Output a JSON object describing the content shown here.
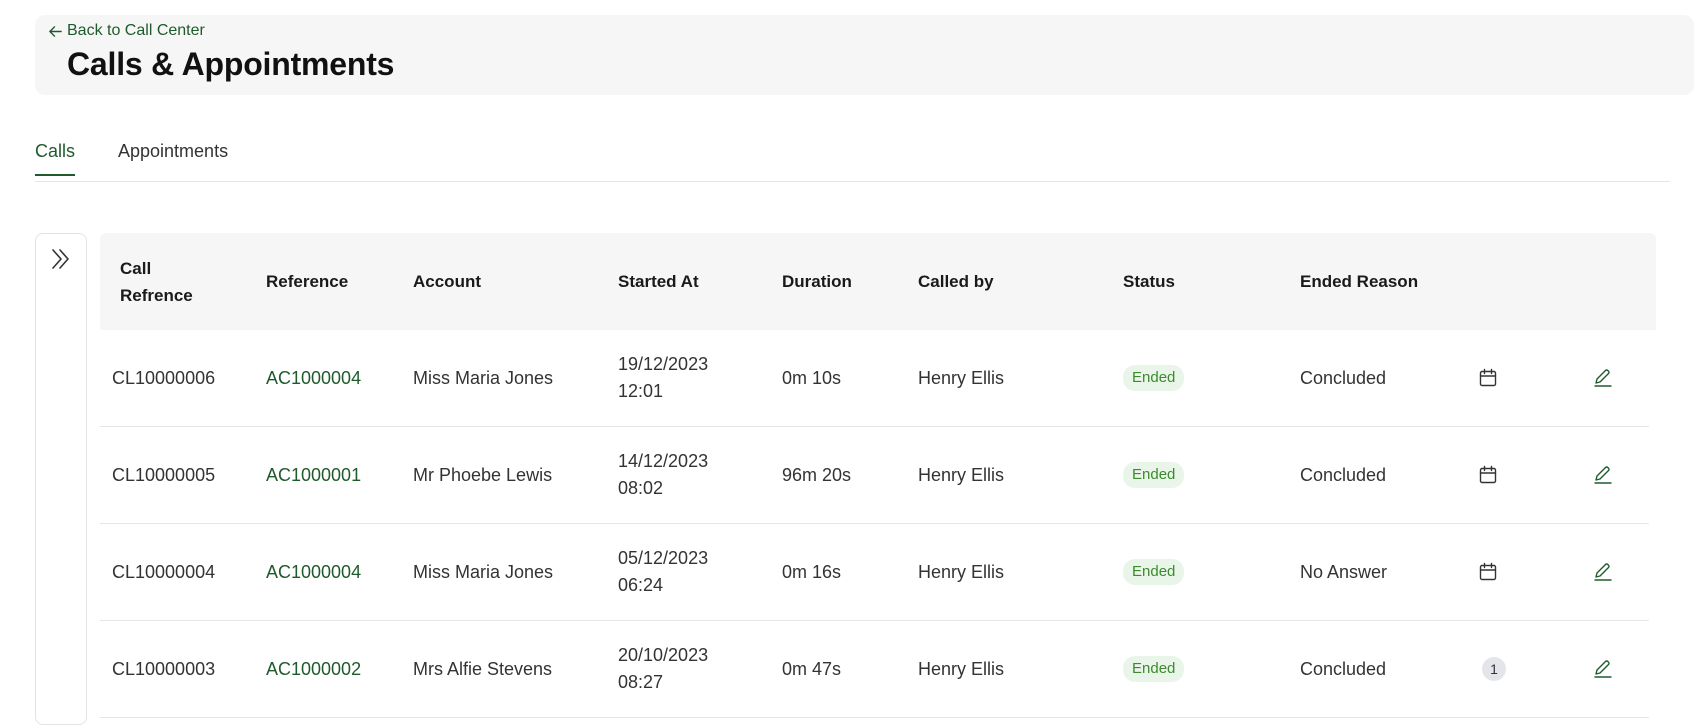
{
  "header": {
    "back_label": "Back to Call Center",
    "title": "Calls & Appointments"
  },
  "tabs": [
    {
      "label": "Calls",
      "active": true
    },
    {
      "label": "Appointments",
      "active": false
    }
  ],
  "table": {
    "headers": [
      "Call\nRefrence",
      "Reference",
      "Account",
      "Started At",
      "Duration",
      "Called by",
      "Status",
      "Ended Reason"
    ],
    "rows": [
      {
        "call_ref": "CL10000006",
        "reference": "AC1000004",
        "account": "Miss Maria Jones",
        "started_date": "19/12/2023",
        "started_time": "12:01",
        "duration": "0m 10s",
        "called_by": "Henry Ellis",
        "status": "Ended",
        "ended_reason": "Concluded",
        "action": "calendar-icon",
        "count": null
      },
      {
        "call_ref": "CL10000005",
        "reference": "AC1000001",
        "account": "Mr Phoebe Lewis",
        "started_date": "14/12/2023",
        "started_time": "08:02",
        "duration": "96m 20s",
        "called_by": "Henry Ellis",
        "status": "Ended",
        "ended_reason": "Concluded",
        "action": "calendar-icon",
        "count": null
      },
      {
        "call_ref": "CL10000004",
        "reference": "AC1000004",
        "account": "Miss Maria Jones",
        "started_date": "05/12/2023",
        "started_time": "06:24",
        "duration": "0m 16s",
        "called_by": "Henry Ellis",
        "status": "Ended",
        "ended_reason": "No Answer",
        "action": "calendar-icon",
        "count": null
      },
      {
        "call_ref": "CL10000003",
        "reference": "AC1000002",
        "account": "Mrs Alfie Stevens",
        "started_date": "20/10/2023",
        "started_time": "08:27",
        "duration": "0m 47s",
        "called_by": "Henry Ellis",
        "status": "Ended",
        "ended_reason": "Concluded",
        "action": "count-badge",
        "count": "1"
      }
    ]
  },
  "colors": {
    "accent": "#1f5a2c",
    "status_bg": "#eaf5ea",
    "status_text": "#3c8a2c",
    "header_bg": "#f6f6f6"
  }
}
